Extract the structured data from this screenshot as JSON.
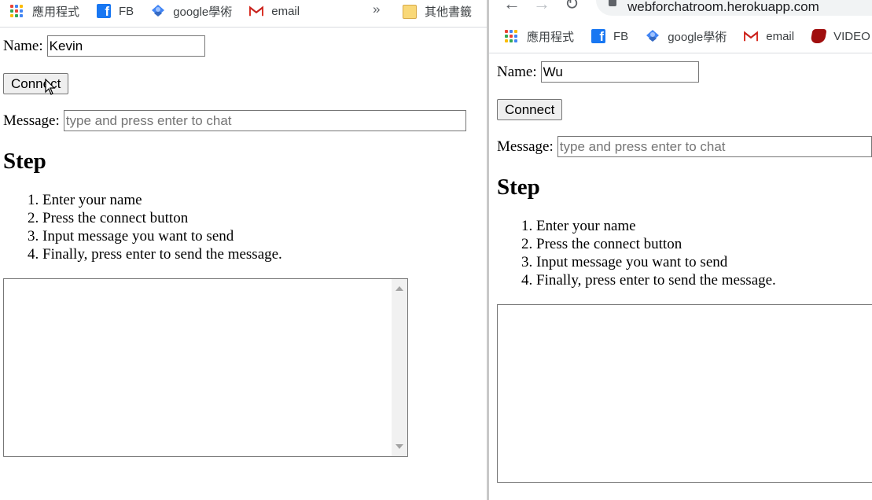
{
  "bookmarks": {
    "apps": "應用程式",
    "fb": "FB",
    "scholar": "google學術",
    "email": "email",
    "more": "»",
    "other": "其他書籤",
    "video": "VIDEO"
  },
  "right_browser": {
    "url": "webforchatroom.herokuapp.com"
  },
  "left": {
    "name_label": "Name:",
    "name_value": "Kevin",
    "connect_label": "Connect",
    "message_label": "Message:",
    "message_placeholder": "type and press enter to chat",
    "heading": "Step",
    "steps": [
      "Enter your name",
      "Press the connect button",
      "Input message you want to send",
      "Finally, press enter to send the message."
    ]
  },
  "right": {
    "name_label": "Name:",
    "name_value": "Wu",
    "connect_label": "Connect",
    "message_label": "Message:",
    "message_placeholder": "type and press enter to chat",
    "heading": "Step",
    "steps": [
      "Enter your name",
      "Press the connect button",
      "Input message you want to send",
      "Finally, press enter to send the message."
    ]
  },
  "colors": {
    "facebook": "#1877f2",
    "scholar": "#4285f4",
    "gmail": "#d93025",
    "folder": "#f9d878",
    "video": "#a00e0e"
  }
}
